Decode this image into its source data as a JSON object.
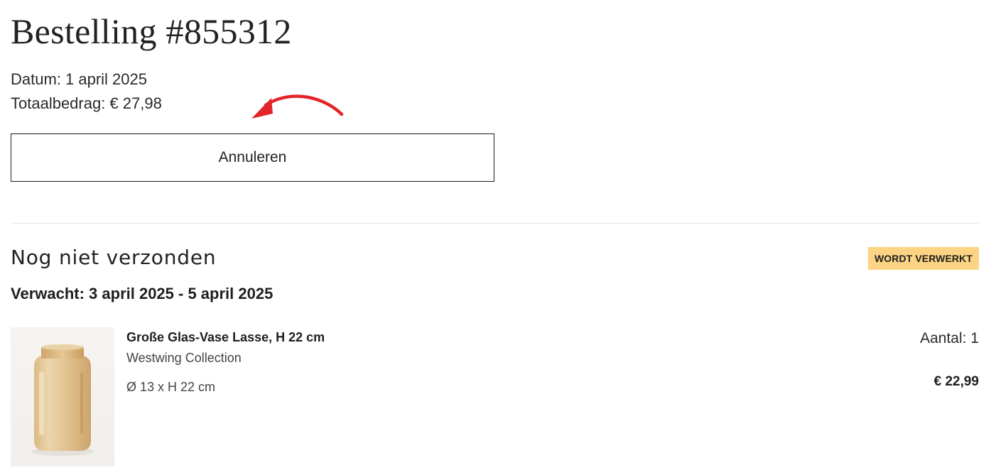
{
  "order": {
    "title": "Bestelling #855312",
    "date_line": "Datum: 1 april 2025",
    "total_line": "Totaalbedrag: € 27,98",
    "cancel_label": "Annuleren"
  },
  "shipment": {
    "title": "Nog niet verzonden",
    "status_badge": "WORDT VERWERKT",
    "expected_line": "Verwacht: 3 april 2025 - 5 april 2025"
  },
  "product": {
    "name": "Große Glas-Vase Lasse, H 22 cm",
    "brand": "Westwing Collection",
    "dimensions": "Ø 13 x H 22 cm",
    "quantity_line": "Aantal: 1",
    "price": "€ 22,99",
    "image_icon": "amber-glass-vase"
  },
  "colors": {
    "badge_background": "#fcd484",
    "annotation_arrow": "#e32428"
  }
}
